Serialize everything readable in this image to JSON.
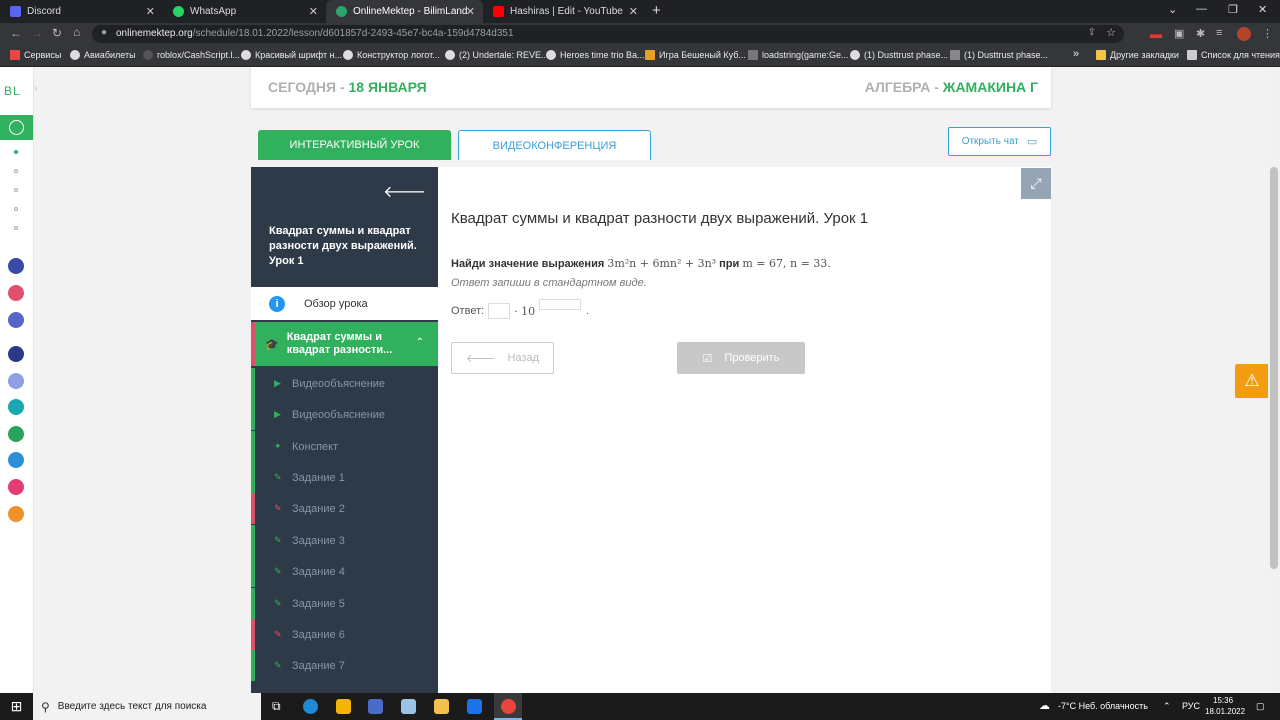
{
  "browser": {
    "tabs": [
      {
        "label": "Discord",
        "color": "#5865f2"
      },
      {
        "label": "WhatsApp",
        "color": "#25d366"
      },
      {
        "label": "OnlineMektep - BilimLand",
        "color": "#2ca46e"
      },
      {
        "label": "Hashiras | Edit - YouTube",
        "color": "#ff0000"
      }
    ],
    "new_tab": "+",
    "url_host": "onlinemektep.org",
    "url_path": "/schedule/18.01.2022/lesson/d601857d-2493-45e7-bc4a-159d4784d351",
    "bookmarks": [
      "Сервисы",
      "Авиабилеты",
      "roblox/CashScript.l...",
      "Красивый шрифт н...",
      "Конструктор логот...",
      "(2) Undertale: REVE...",
      "Heroes time trio Ba...",
      "Игра Бешеный Куб...",
      "loadstring(game:Ge...",
      "(1) Dusttrust phase...",
      "(1) Dusttrust phase..."
    ],
    "bookmark_more": "»",
    "other_bookmarks": "Другие закладки",
    "reading_list": "Список для чтения"
  },
  "left_rail": {
    "logo": "BL"
  },
  "header": {
    "today_prefix": "СЕГОДНЯ - ",
    "today_date": "18 ЯНВАРЯ",
    "subject_prefix": "АЛГЕБРА - ",
    "teacher": "ЖАМАКИНА Г"
  },
  "tabs": {
    "interactive": "ИНТЕРАКТИВНЫЙ УРОК",
    "video_conf": "ВИДЕОКОНФЕРЕНЦИЯ"
  },
  "chat_button": "Открыть чат",
  "sidebar": {
    "title": "Квадрат суммы и квадрат разности двух выражений. Урок 1",
    "overview": "Обзор урока",
    "active_section": "Квадрат суммы и квадрат разности...",
    "items": [
      {
        "label": "Видеообъяснение",
        "icon": "play-icon",
        "glyph": "▶",
        "status": "ok"
      },
      {
        "label": "Видеообъяснение",
        "icon": "play-icon",
        "glyph": "▶",
        "status": "ok"
      },
      {
        "label": "Конспект",
        "icon": "book-icon",
        "glyph": "✦",
        "status": "ok"
      },
      {
        "label": "Задание 1",
        "icon": "edit-icon",
        "glyph": "✎",
        "status": "ok"
      },
      {
        "label": "Задание 2",
        "icon": "edit-icon",
        "glyph": "✎",
        "status": "error"
      },
      {
        "label": "Задание 3",
        "icon": "edit-icon",
        "glyph": "✎",
        "status": "ok"
      },
      {
        "label": "Задание 4",
        "icon": "edit-icon",
        "glyph": "✎",
        "status": "ok"
      },
      {
        "label": "Задание 5",
        "icon": "edit-icon",
        "glyph": "✎",
        "status": "ok"
      },
      {
        "label": "Задание 6",
        "icon": "edit-icon",
        "glyph": "✎",
        "status": "error"
      },
      {
        "label": "Задание 7",
        "icon": "edit-icon",
        "glyph": "✎",
        "status": "ok"
      }
    ]
  },
  "lesson": {
    "title": "Квадрат суммы и квадрат разности двух выражений. Урок 1",
    "task_prefix": "Найди значение выражения",
    "expression": "3m²n + 6mn² + 3n³",
    "task_when": "при",
    "values": "m = 67, n = 33.",
    "hint": "Ответ запиши в стандартном виде.",
    "answer_label": "Ответ:",
    "times": "· 10",
    "period": "."
  },
  "buttons": {
    "back": "Назад",
    "check": "Проверить"
  },
  "taskbar": {
    "search_placeholder": "Введите здесь текст для поиска",
    "weather": "-7°C  Неб. облачность",
    "language": "РУС",
    "time": "15:36",
    "date": "18.01.2022"
  }
}
